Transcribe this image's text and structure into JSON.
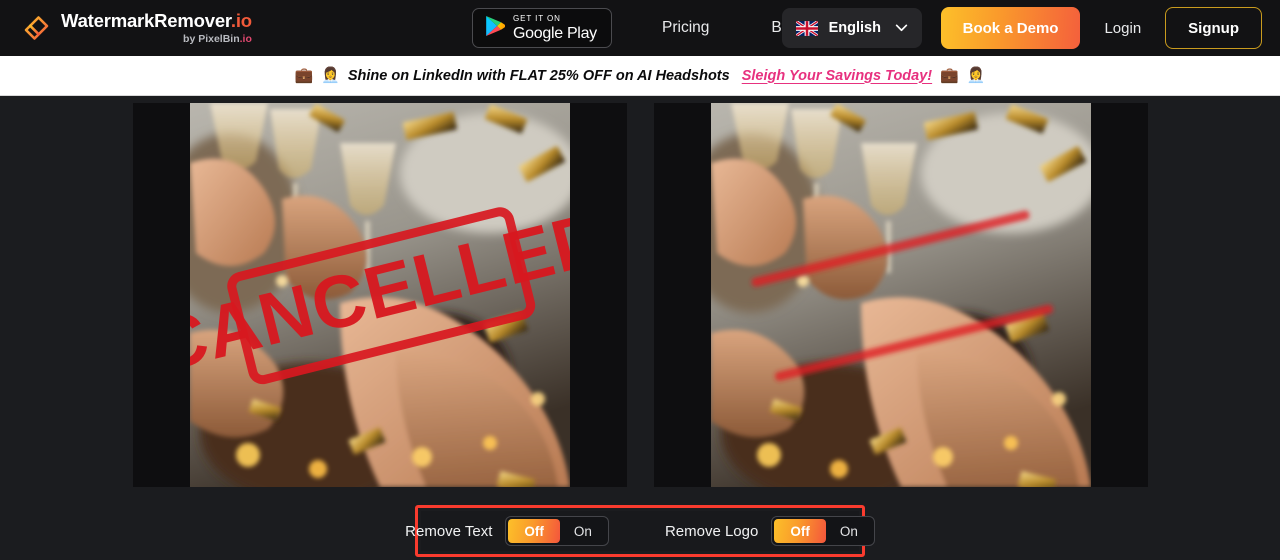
{
  "brand": {
    "logo_icon": "eraser-icon",
    "name": "WatermarkRemover",
    "name_tld": ".io",
    "byline_prefix": "by PixelBin",
    "byline_tld": ".io"
  },
  "header": {
    "google_play": {
      "icon": "google-play-icon",
      "line1": "GET IT ON",
      "line2": "Google Play"
    },
    "nav": [
      {
        "label": "Pricing"
      },
      {
        "label": "Blog"
      }
    ],
    "language": {
      "flag_icon": "uk-flag-icon",
      "selected": "English",
      "chevron_icon": "chevron-down-icon"
    },
    "demo_button": "Book a Demo",
    "login_link": "Login",
    "signup_button": "Signup"
  },
  "promo_banner": {
    "emoji_left_1": "💼",
    "emoji_left_2": "👩‍💼",
    "text": "Shine on LinkedIn with FLAT 25% OFF on AI Headshots",
    "cta": "Sleigh Your Savings Today!",
    "emoji_right_1": "💼",
    "emoji_right_2": "👩‍💼"
  },
  "compare": {
    "before": {
      "alt": "original celebration photo with CANCELLED watermark",
      "watermark_text": "CANCELLED"
    },
    "after": {
      "alt": "processed celebration photo with watermark text removed"
    }
  },
  "controls": {
    "remove_text": {
      "label": "Remove Text",
      "off_label": "Off",
      "on_label": "On",
      "selected": "Off"
    },
    "remove_logo": {
      "label": "Remove Logo",
      "off_label": "Off",
      "on_label": "On",
      "selected": "Off"
    }
  },
  "colors": {
    "accent_gradient_start": "#fcc02a",
    "accent_gradient_end": "#f4563c",
    "promo_cta": "#e7317f",
    "highlight_border": "#fa3b2e",
    "header_bg": "#121214",
    "page_bg": "#1b1c1f",
    "pane_bg": "#0e0e10",
    "watermark_red": "#d8181f"
  }
}
